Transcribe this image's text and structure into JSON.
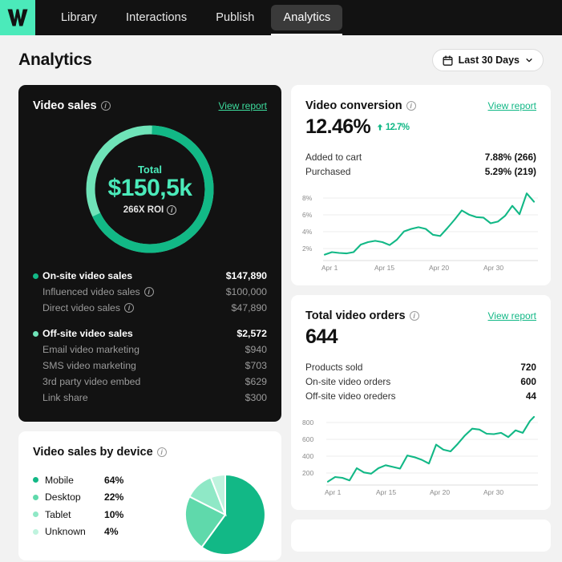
{
  "nav": {
    "logo_icon": "wistia-w-logo",
    "tabs": [
      {
        "label": "Library",
        "active": false
      },
      {
        "label": "Interactions",
        "active": false
      },
      {
        "label": "Publish",
        "active": false
      },
      {
        "label": "Analytics",
        "active": true
      }
    ]
  },
  "header": {
    "title": "Analytics",
    "date_range": "Last 30 Days",
    "calendar_icon": "calendar-icon",
    "chevron_icon": "chevron-down-icon"
  },
  "video_sales": {
    "title": "Video sales",
    "view_report": "View report",
    "donut": {
      "center_label": "Total",
      "center_value": "$150,5k",
      "roi": "266X ROI",
      "segments": [
        {
          "name": "On-site video sales",
          "value": 147890,
          "color": "#12b886"
        },
        {
          "name": "Off-site video sales",
          "value": 2572,
          "color": "#6fe3b8"
        }
      ]
    },
    "groups": [
      {
        "label": "On-site video sales",
        "value": "$147,890",
        "color": "#12b886",
        "items": [
          {
            "label": "Influenced video sales",
            "value": "$100,000",
            "info": true
          },
          {
            "label": "Direct video sales",
            "value": "$47,890",
            "info": true
          }
        ]
      },
      {
        "label": "Off-site video sales",
        "value": "$2,572",
        "color": "#6fe3b8",
        "items": [
          {
            "label": "Email video marketing",
            "value": "$940",
            "info": false
          },
          {
            "label": "SMS video marketing",
            "value": "$703",
            "info": false
          },
          {
            "label": "3rd party video embed",
            "value": "$629",
            "info": false
          },
          {
            "label": "Link share",
            "value": "$300",
            "info": false
          }
        ]
      }
    ]
  },
  "video_conversion": {
    "title": "Video conversion",
    "view_report": "View report",
    "value": "12.46%",
    "delta": "12.7%",
    "delta_direction": "up",
    "rows": [
      {
        "label": "Added to cart",
        "value": "7.88% (266)"
      },
      {
        "label": "Purchased",
        "value": "5.29% (219)"
      }
    ]
  },
  "total_orders": {
    "title": "Total video orders",
    "view_report": "View report",
    "value": "644",
    "rows": [
      {
        "label": "Products sold",
        "value": "720"
      },
      {
        "label": "On-site video orders",
        "value": "600"
      },
      {
        "label": "Off-site video oreders",
        "value": "44"
      }
    ]
  },
  "device": {
    "title": "Video sales by device",
    "rows": [
      {
        "label": "Mobile",
        "value": "64%",
        "color": "#12b886"
      },
      {
        "label": "Desktop",
        "value": "22%",
        "color": "#5fd9ab"
      },
      {
        "label": "Tablet",
        "value": "10%",
        "color": "#8fe8c6"
      },
      {
        "label": "Unknown",
        "value": "4%",
        "color": "#bff3de"
      }
    ]
  },
  "chart_data": [
    {
      "type": "line",
      "id": "conversion-trend",
      "title": "Video conversion",
      "ylabel": "",
      "xlabel": "",
      "ylim": [
        0,
        9
      ],
      "yticks": [
        2,
        4,
        6,
        8
      ],
      "ytick_labels": [
        "2%",
        "4%",
        "6%",
        "8%"
      ],
      "xticks": [
        "Apr 1",
        "Apr 15",
        "Apr 20",
        "Apr 30"
      ],
      "grid": true,
      "color": "#12b886",
      "values": [
        0.7,
        1.0,
        0.9,
        0.85,
        1.0,
        1.9,
        2.2,
        2.35,
        2.2,
        1.95,
        2.6,
        3.6,
        3.9,
        4.1,
        3.9,
        3.2,
        3.05,
        4.0,
        5.0,
        6.1,
        5.6,
        5.3,
        5.25,
        4.6,
        4.8,
        5.5,
        6.7,
        5.7,
        8.2,
        7.2
      ]
    },
    {
      "type": "line",
      "id": "orders-trend",
      "title": "Total video orders",
      "ylabel": "",
      "xlabel": "",
      "ylim": [
        0,
        900
      ],
      "yticks": [
        200,
        400,
        600,
        800
      ],
      "ytick_labels": [
        "200",
        "400",
        "600",
        "800"
      ],
      "xticks": [
        "Apr 1",
        "Apr 15",
        "Apr 20",
        "Apr 30"
      ],
      "grid": true,
      "color": "#12b886",
      "values": [
        40,
        95,
        85,
        55,
        200,
        150,
        135,
        200,
        235,
        215,
        195,
        350,
        330,
        300,
        255,
        480,
        420,
        400,
        490,
        590,
        670,
        660,
        610,
        605,
        620,
        570,
        650,
        620,
        760,
        810
      ]
    },
    {
      "type": "pie",
      "id": "sales-by-device",
      "title": "Video sales by device",
      "categories": [
        "Mobile",
        "Desktop",
        "Tablet",
        "Unknown"
      ],
      "values": [
        64,
        22,
        10,
        4
      ],
      "colors": [
        "#12b886",
        "#5fd9ab",
        "#8fe8c6",
        "#bff3de"
      ],
      "legend": "left"
    },
    {
      "type": "pie",
      "id": "video-sales-donut",
      "title": "Video sales",
      "categories": [
        "On-site video sales",
        "Off-site video sales"
      ],
      "values": [
        147890,
        2572
      ],
      "colors": [
        "#12b886",
        "#6fe3b8"
      ],
      "donut": true,
      "center_value": "$150,5k"
    }
  ]
}
